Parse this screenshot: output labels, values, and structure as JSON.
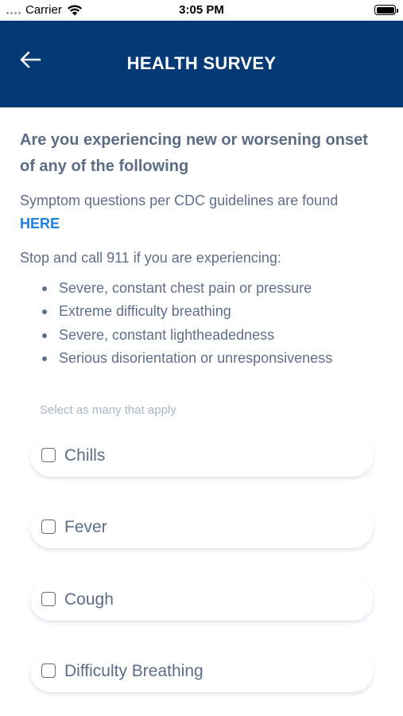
{
  "status_bar": {
    "carrier": "Carrier",
    "time": "3:05 PM"
  },
  "header": {
    "title": "HEALTH SURVEY",
    "background": "#053a77"
  },
  "question": "Are you experiencing new or worsening onset of any of the following",
  "cdc_text": "Symptom questions per CDC guidelines are found",
  "cdc_link": "HERE",
  "stop_text": "Stop and call 911 if you are experiencing:",
  "emergency_symptoms": [
    "Severe, constant chest pain or pressure",
    "Extreme difficulty breathing",
    "Severe, constant lightheadedness",
    "Serious disorientation or unresponsiveness"
  ],
  "helper_text": "Select as many that apply",
  "options": [
    {
      "label": "Chills",
      "checked": false
    },
    {
      "label": "Fever",
      "checked": false
    },
    {
      "label": "Cough",
      "checked": false
    },
    {
      "label": "Difficulty Breathing",
      "checked": false
    }
  ],
  "colors": {
    "accent": "#1e80e6",
    "text": "#5f6f8a"
  }
}
